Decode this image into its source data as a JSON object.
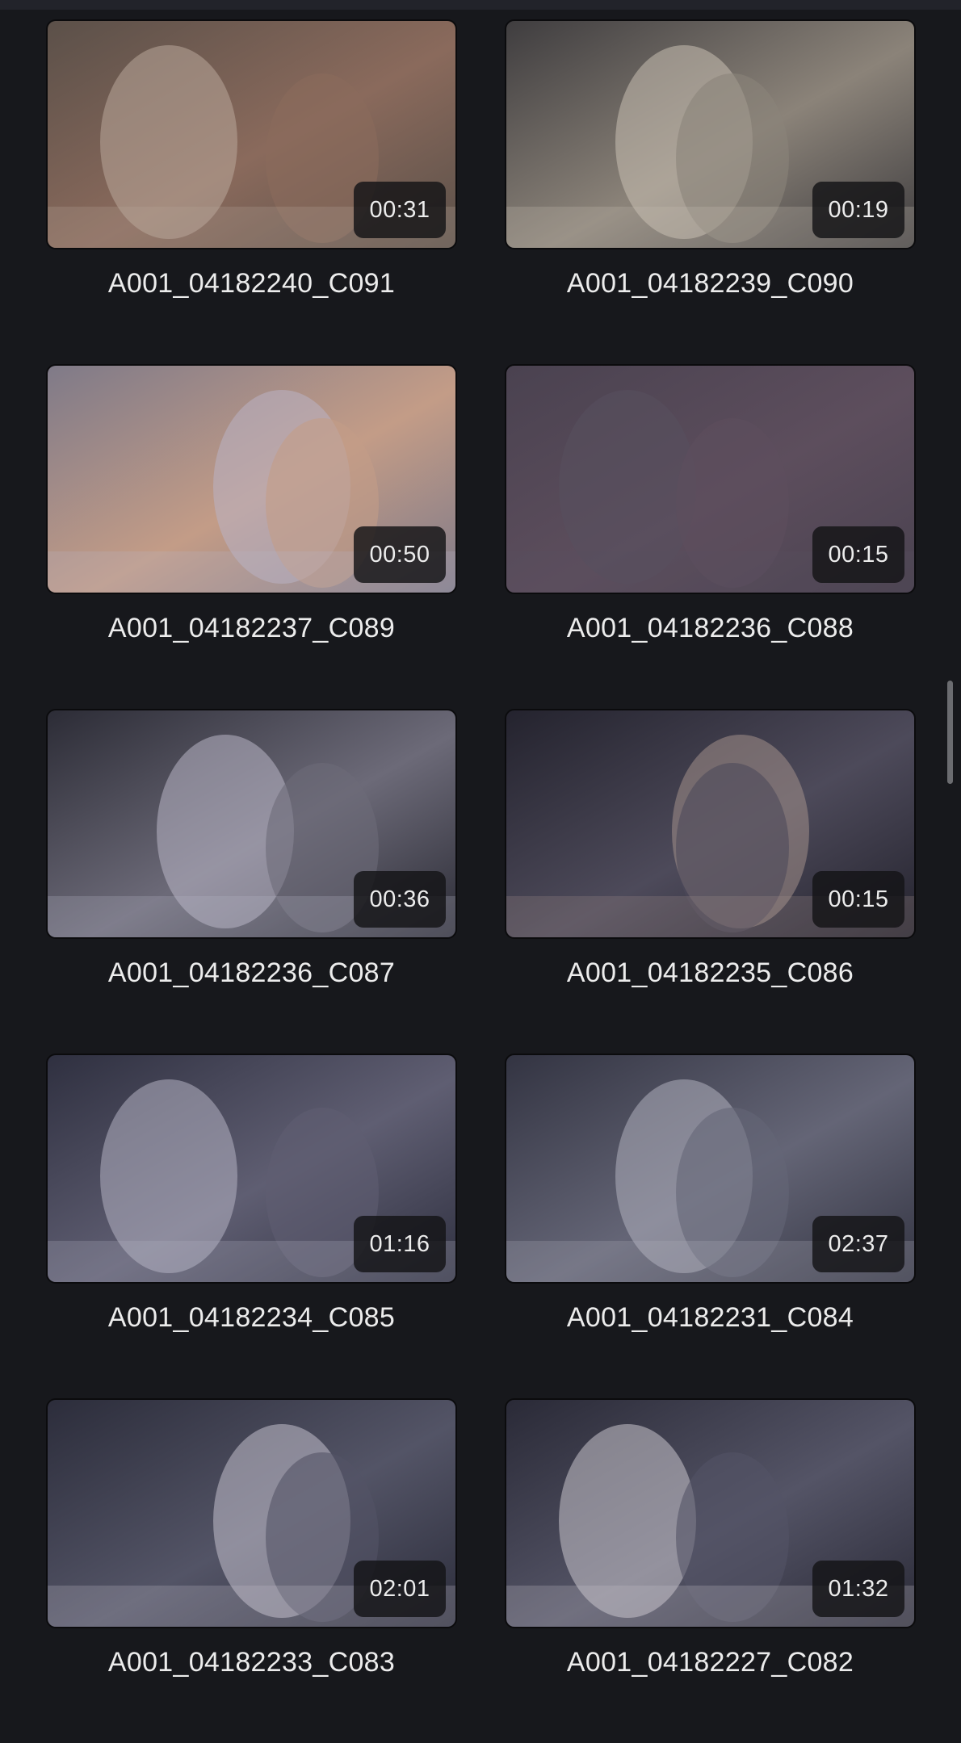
{
  "clips": [
    {
      "name": "A001_04182240_C091",
      "duration": "00:31",
      "palette": [
        "#5b5049",
        "#8a6a5c",
        "#b9a89a"
      ]
    },
    {
      "name": "A001_04182239_C090",
      "duration": "00:19",
      "palette": [
        "#3f3d3f",
        "#8b8379",
        "#c9bfb2"
      ]
    },
    {
      "name": "A001_04182237_C089",
      "duration": "00:50",
      "palette": [
        "#7f7a88",
        "#c39c87",
        "#b9b3c4"
      ]
    },
    {
      "name": "A001_04182236_C088",
      "duration": "00:15",
      "palette": [
        "#4a4250",
        "#5d4e5d",
        "#57505f"
      ]
    },
    {
      "name": "A001_04182236_C087",
      "duration": "00:36",
      "palette": [
        "#2c2c36",
        "#6c6a78",
        "#b9b7c6"
      ]
    },
    {
      "name": "A001_04182235_C086",
      "duration": "00:15",
      "palette": [
        "#24232e",
        "#4d4a5a",
        "#a3908a"
      ]
    },
    {
      "name": "A001_04182234_C085",
      "duration": "01:16",
      "palette": [
        "#2f3040",
        "#5f5e72",
        "#b4b2c2"
      ]
    },
    {
      "name": "A001_04182231_C084",
      "duration": "02:37",
      "palette": [
        "#333442",
        "#646576",
        "#b0b0bd"
      ]
    },
    {
      "name": "A001_04182233_C083",
      "duration": "02:01",
      "palette": [
        "#2c2d3b",
        "#535466",
        "#c3c0cc"
      ]
    },
    {
      "name": "A001_04182227_C082",
      "duration": "01:32",
      "palette": [
        "#2a2a37",
        "#545466",
        "#c8c4cc"
      ]
    }
  ],
  "icons": {
    "scrollbar": "scrollbar-thumb"
  }
}
